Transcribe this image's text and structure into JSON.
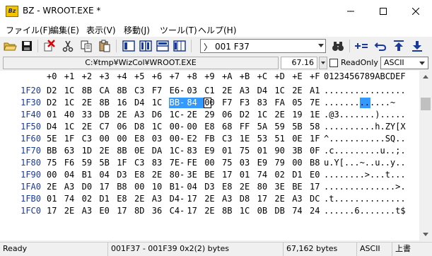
{
  "window": {
    "title": "BZ - WROOT.EXE *",
    "app_icon_text": "Bz"
  },
  "menu": [
    "ファイル(F)",
    "編集(E)",
    "表示(V)",
    "移動(J)",
    "ツール(T)",
    "ヘルプ(H)"
  ],
  "toolbar": {
    "buttons": [
      "open-icon",
      "save-icon",
      "delete-icon",
      "cut-icon",
      "copy-icon",
      "paste-icon",
      "single-view-icon",
      "split-view-icon",
      "compare-icon",
      "multi-view-icon",
      "binoculars-icon",
      "plus-equals-icon",
      "undo-icon",
      "jump-top-icon",
      "jump-bottom-icon"
    ],
    "address_value": "001 F37"
  },
  "pathbar": {
    "path": "C:¥tmp¥WizCol¥WROOT.EXE",
    "size": "67.16 kB",
    "readonly_label": "ReadOnly",
    "readonly_checked": false,
    "encoding": "ASCII"
  },
  "hex": {
    "header_cols": [
      "+0",
      "+1",
      "+2",
      "+3",
      "+4",
      "+5",
      "+6",
      "+7",
      "+8",
      "+9",
      "+A",
      "+B",
      "+C",
      "+D",
      "+E",
      "+F"
    ],
    "ascii_header": "0123456789ABCDEF",
    "rows": [
      {
        "offset": "1F20",
        "bytes": [
          "D2",
          "1C",
          "8B",
          "CA",
          "8B",
          "C3",
          "F7",
          "E6-",
          "03",
          "C1",
          "2E",
          "A3",
          "D4",
          "1C",
          "2E",
          "A1"
        ],
        "ascii": "................"
      },
      {
        "offset": "1F30",
        "bytes": [
          "D2",
          "1C",
          "2E",
          "8B",
          "16",
          "D4",
          "1C",
          "BB-",
          "84",
          "00",
          "F7",
          "F3",
          "83",
          "FA",
          "05",
          "7E"
        ],
        "ascii": ".............~"
      },
      {
        "offset": "1F40",
        "bytes": [
          "01",
          "40",
          "33",
          "DB",
          "2E",
          "A3",
          "D6",
          "1C-",
          "2E",
          "29",
          "06",
          "D2",
          "1C",
          "2E",
          "19",
          "1E"
        ],
        "ascii": ".@3.......)....."
      },
      {
        "offset": "1F50",
        "bytes": [
          "D4",
          "1C",
          "2E",
          "C7",
          "06",
          "D8",
          "1C",
          "00-",
          "00",
          "E8",
          "68",
          "FF",
          "5A",
          "59",
          "5B",
          "58"
        ],
        "ascii": "..........h.ZY[X"
      },
      {
        "offset": "1F60",
        "bytes": [
          "5E",
          "1F",
          "C3",
          "00",
          "00",
          "E8",
          "03",
          "00-",
          "E2",
          "FB",
          "C3",
          "1E",
          "53",
          "51",
          "0E",
          "1F"
        ],
        "ascii": "^...........SQ.."
      },
      {
        "offset": "1F70",
        "bytes": [
          "BB",
          "63",
          "1D",
          "2E",
          "8B",
          "0E",
          "DA",
          "1C-",
          "83",
          "E9",
          "01",
          "75",
          "01",
          "90",
          "3B",
          "0F"
        ],
        "ascii": ".c.........u..;."
      },
      {
        "offset": "1F80",
        "bytes": [
          "75",
          "F6",
          "59",
          "5B",
          "1F",
          "C3",
          "83",
          "7E-",
          "FE",
          "00",
          "75",
          "03",
          "E9",
          "79",
          "00",
          "B8"
        ],
        "ascii": "u.Y[...~..u..y.."
      },
      {
        "offset": "1F90",
        "bytes": [
          "00",
          "04",
          "B1",
          "04",
          "D3",
          "E8",
          "2E",
          "80-",
          "3E",
          "BE",
          "17",
          "01",
          "74",
          "02",
          "D1",
          "E0"
        ],
        "ascii": "........>...t..."
      },
      {
        "offset": "1FA0",
        "bytes": [
          "2E",
          "A3",
          "D0",
          "17",
          "B8",
          "00",
          "10",
          "B1-",
          "04",
          "D3",
          "E8",
          "2E",
          "80",
          "3E",
          "BE",
          "17"
        ],
        "ascii": "..............>."
      },
      {
        "offset": "1FB0",
        "bytes": [
          "01",
          "74",
          "02",
          "D1",
          "E8",
          "2E",
          "A3",
          "D4-",
          "17",
          "2E",
          "A3",
          "D8",
          "17",
          "2E",
          "A3",
          "DC"
        ],
        "ascii": ".t.............."
      },
      {
        "offset": "1FC0",
        "bytes": [
          "17",
          "2E",
          "A3",
          "E0",
          "17",
          "8D",
          "36",
          "C4-",
          "17",
          "2E",
          "8B",
          "1C",
          "0B",
          "DB",
          "74",
          "24"
        ],
        "ascii": "......6.......t$"
      }
    ]
  },
  "status": {
    "ready": "Ready",
    "selection": "001F37 - 001F39 0x2(2) bytes",
    "filesize": "67,162 bytes",
    "encoding": "ASCII",
    "mode": "上書"
  }
}
